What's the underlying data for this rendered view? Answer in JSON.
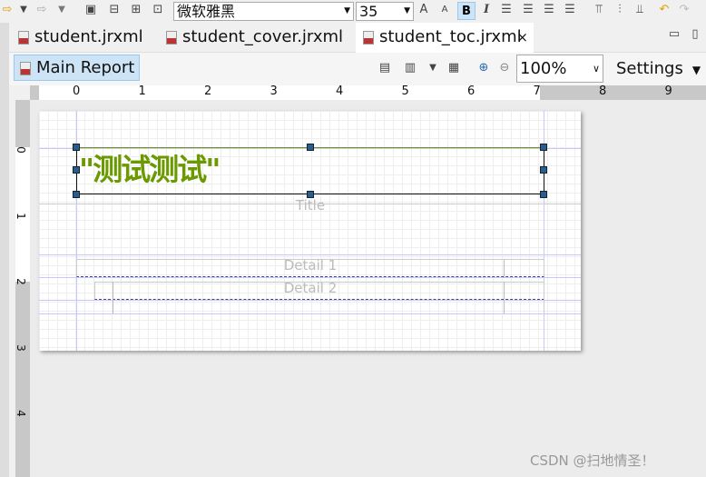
{
  "toolbar": {
    "font_family": "微软雅黑",
    "font_size": "35",
    "icons": [
      "forward-icon",
      "dropdown-icon",
      "new-icon",
      "align-icon",
      "align-icon",
      "align-icon",
      "font-increase-icon",
      "font-decrease-icon",
      "bold-icon",
      "italic-icon",
      "align-left-icon",
      "align-center-icon",
      "align-right-icon",
      "justify-icon",
      "valign-top-icon",
      "valign-middle-icon",
      "valign-bottom-icon",
      "undo-icon",
      "redo-icon"
    ],
    "bold": "B",
    "italic": "I"
  },
  "tabs": [
    {
      "label": "student.jrxml"
    },
    {
      "label": "student_cover.jrxml"
    },
    {
      "label": "student_toc.jrxml",
      "active": true,
      "close": "×"
    }
  ],
  "editor": {
    "main_report": "Main Report",
    "zoom": "100%",
    "settings": "Settings"
  },
  "ruler": {
    "h": [
      "0",
      "1",
      "2",
      "3",
      "4",
      "5",
      "6",
      "7",
      "8",
      "9"
    ],
    "v": [
      "0",
      "1",
      "2",
      "3",
      "4"
    ]
  },
  "report": {
    "text_field": "\"测试测试\"",
    "text_color": "#6a9a00",
    "bands": [
      "Title",
      "Detail 1",
      "Detail 2"
    ]
  },
  "watermark": "CSDN @扫地情圣！"
}
